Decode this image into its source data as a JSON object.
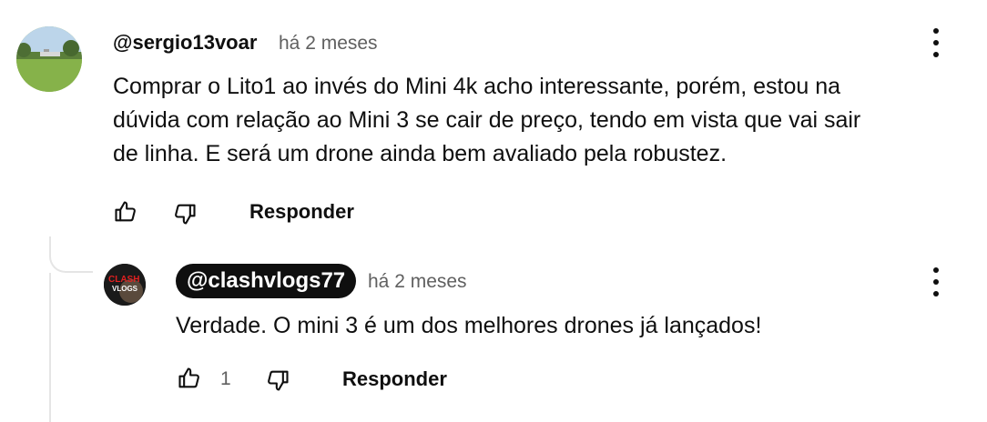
{
  "comment": {
    "author": "@sergio13voar",
    "time": "há 2 meses",
    "text": "Comprar o Lito1 ao invés do Mini 4k acho interessante, porém, estou na\ndúvida com relação ao Mini 3 se cair de preço, tendo em vista que vai sair\nde linha. E será um drone ainda bem avaliado pela robustez.",
    "reply_label": "Responder"
  },
  "reply": {
    "author": "@clashvlogs77",
    "time": "há 2 meses",
    "text": "Verdade. O mini 3 é um dos melhores drones já lançados!",
    "like_count": "1",
    "reply_label": "Responder",
    "avatar_text_top": "CLASH",
    "avatar_text_bottom": "VLOGS"
  },
  "icons": {
    "like": "thumbs-up-icon",
    "dislike": "thumbs-down-icon",
    "menu": "more-vertical-icon"
  },
  "colors": {
    "text": "#0f0f0f",
    "secondary": "#606060",
    "chip": "#0f0f0f",
    "thread_line": "#e5e5e5"
  }
}
